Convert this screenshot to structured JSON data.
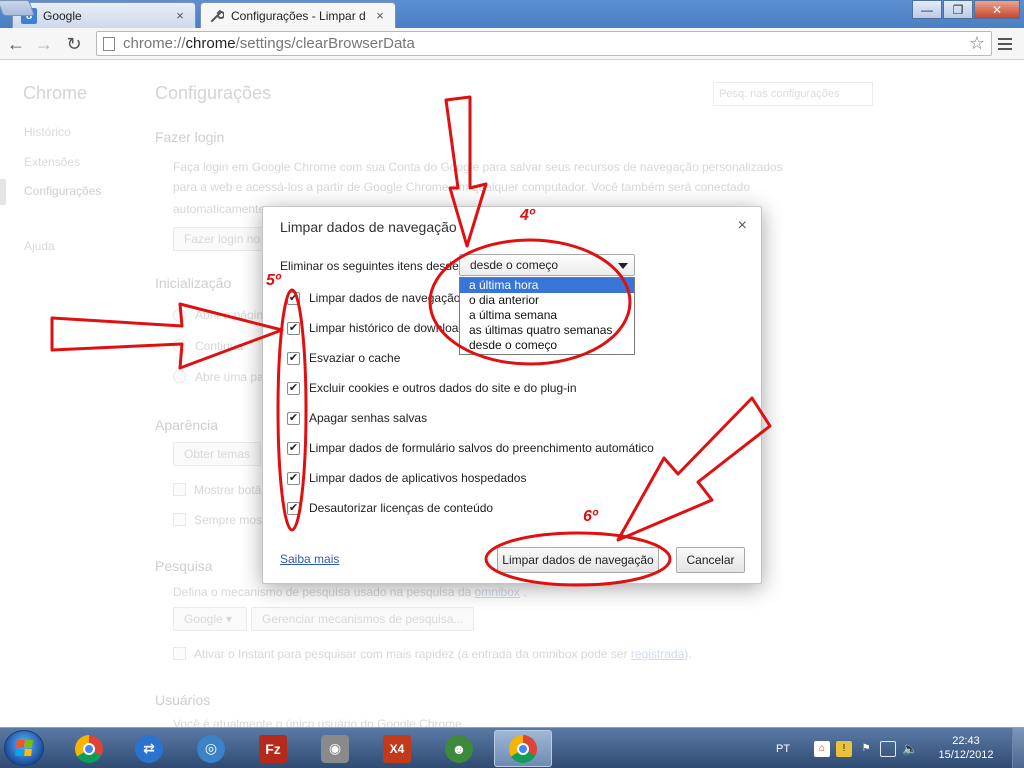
{
  "browser": {
    "tabs": [
      {
        "title": "Google",
        "favicon": "google-g-icon",
        "active": false
      },
      {
        "title": "Configurações - Limpar d",
        "favicon": "wrench-icon",
        "active": true
      }
    ],
    "tab_close_glyph": "×",
    "window_buttons": {
      "minimize": "—",
      "maximize": "❐",
      "close": "✕"
    },
    "nav": {
      "back": "←",
      "forward": "→",
      "reload": "↻"
    },
    "url_prefix": "chrome://",
    "url_host": "chrome",
    "url_path": "/settings/clearBrowserData",
    "star": "☆"
  },
  "settings": {
    "sidebar": {
      "title": "Chrome",
      "items": [
        "Histórico",
        "Extensões",
        "Configurações",
        "Ajuda"
      ]
    },
    "page_title": "Configurações",
    "search_placeholder": "Pesq. nas configurações",
    "sections": {
      "login_heading": "Fazer login",
      "login_text_1": "Faça login em Google Chrome com sua Conta do Google para salvar seus recursos de navegação personalizados",
      "login_text_2": "para a web e acessá-los a partir de Google Chrome em qualquer computador. Você também será conectado",
      "login_text_3": "automaticamente",
      "login_button": "Fazer login no",
      "startup_heading": "Inicialização",
      "startup_opt1": "Abrir a págin",
      "startup_opt2": "Continua",
      "startup_opt3": "Abre uma pa",
      "appearance_heading": "Aparência",
      "themes_button": "Obter temas",
      "appearance_opt1": "Mostrar botã",
      "appearance_opt2": "Sempre most",
      "search_heading": "Pesquisa",
      "search_text": "Defina o mecanismo de pesquisa usado na pesquisa da",
      "search_link": "omnibox",
      "search_text_end": ".",
      "engine_select": "Google",
      "manage_engines": "Gerenciar mecanismos de pesquisa...",
      "instant_text": "Ativar o Instant para pesquisar com mais rapidez (a entrada da omnibox pode ser",
      "instant_link": "registrada",
      "instant_end": ").",
      "users_heading": "Usuários",
      "users_text": "Você é atualmente o único usuário do Google Chrome."
    }
  },
  "dialog": {
    "title": "Limpar dados de navegação",
    "close": "×",
    "range_label": "Eliminar os seguintes itens desde:",
    "range_value": "desde o começo",
    "range_options": [
      {
        "label": "a última hora",
        "selected": true
      },
      {
        "label": "o dia anterior",
        "selected": false
      },
      {
        "label": "a última semana",
        "selected": false
      },
      {
        "label": "as últimas quatro semanas",
        "selected": false
      },
      {
        "label": "desde o começo",
        "selected": false
      }
    ],
    "checkboxes": [
      {
        "label": "Limpar dados de navegação",
        "checked": true
      },
      {
        "label": "Limpar histórico de download",
        "checked": true
      },
      {
        "label": "Esvaziar o cache",
        "checked": true
      },
      {
        "label": "Excluir cookies e outros dados do site e do plug-in",
        "checked": true
      },
      {
        "label": "Apagar senhas salvas",
        "checked": true
      },
      {
        "label": "Limpar dados de formulário salvos do preenchimento automático",
        "checked": true
      },
      {
        "label": "Limpar dados de aplicativos hospedados",
        "checked": true
      },
      {
        "label": "Desautorizar licenças de conteúdo",
        "checked": true
      }
    ],
    "check_glyph": "✔",
    "learn_more": "Saiba mais",
    "clear_button": "Limpar dados de navegação",
    "cancel_button": "Cancelar"
  },
  "annotations": {
    "color": "#e01010",
    "step_4": "4º",
    "step_5": "5º",
    "step_6": "6º"
  },
  "taskbar": {
    "apps": [
      {
        "name": "chrome-icon",
        "glyph": "",
        "color": "#d8402f",
        "active": false
      },
      {
        "name": "teamviewer-icon",
        "glyph": "⇄",
        "color": "#2a74d0",
        "active": false
      },
      {
        "name": "app-swirl-icon",
        "glyph": "◎",
        "color": "#3a83c8",
        "active": false
      },
      {
        "name": "filezilla-icon",
        "glyph": "Fz",
        "color": "#b52a1c",
        "active": false
      },
      {
        "name": "scanner-icon",
        "glyph": "◉",
        "color": "#8a8a8a",
        "active": false
      },
      {
        "name": "x4-icon",
        "glyph": "X4",
        "color": "#c23a1a",
        "active": false
      },
      {
        "name": "users-icon",
        "glyph": "☻",
        "color": "#3d8a3d",
        "active": false
      },
      {
        "name": "chrome-active-icon",
        "glyph": "",
        "color": "#d8402f",
        "active": true
      }
    ],
    "language": "PT",
    "tray_icons": [
      "antivirus-icon",
      "network-status-icon",
      "flag-icon",
      "monitor-icon",
      "volume-icon"
    ],
    "time": "22:43",
    "date": "15/12/2012"
  }
}
